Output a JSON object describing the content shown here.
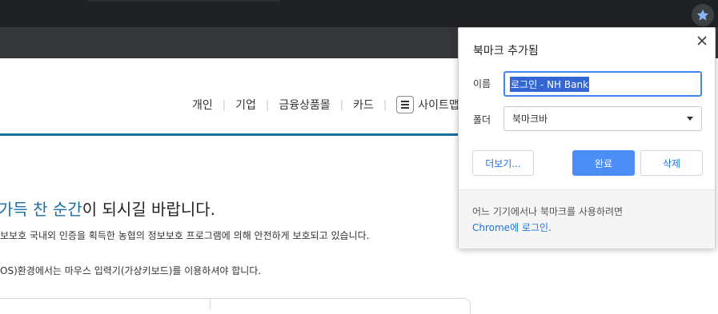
{
  "browser": {
    "bookmark_star": "star-icon"
  },
  "page": {
    "nav": [
      "개인",
      "기업",
      "금융상품몰",
      "카드"
    ],
    "sitemap_label": "사이트맵",
    "headline_highlight": "가득 찬 순간",
    "headline_rest": "이 되시길 바랍니다.",
    "desc1": "보보호 국내외 인증을 획득한 농협의 정보보호 프로그램에 의해 안전하게 보호되고 있습니다.",
    "desc2": "OS)환경에서는 마우스 입력기(가상키보드)를 이용하셔야 합니다."
  },
  "popup": {
    "title": "북마크 추가됨",
    "name_label": "이름",
    "name_value": "로그인 - NH Bank",
    "folder_label": "폴더",
    "folder_value": "북마크바",
    "more_button": "더보기...",
    "done_button": "완료",
    "remove_button": "삭제",
    "footer_text": "어느 기기에서나 북마크를 사용하려면",
    "footer_link": "Chrome에 로그인",
    "footer_suffix": "."
  },
  "colors": {
    "accent": "#4b8ef5",
    "link": "#1a73e8",
    "brand_blue": "#1570a6"
  }
}
